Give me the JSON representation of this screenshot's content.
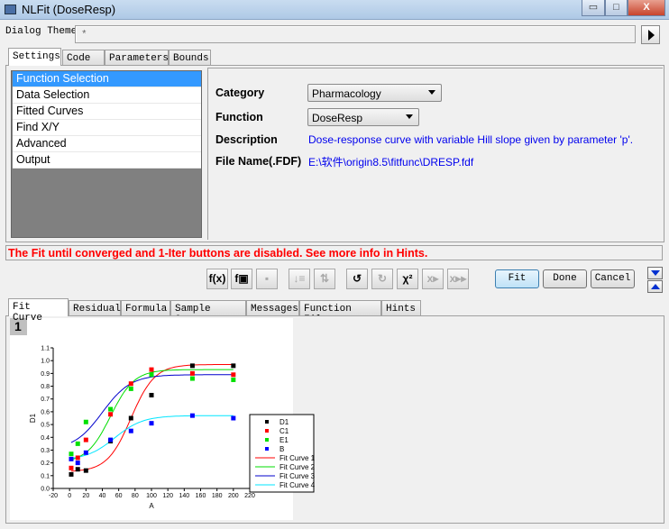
{
  "window": {
    "title": "NLFit (DoseResp)",
    "minimize": "▭",
    "maximize": "□",
    "close": "X"
  },
  "theme": {
    "label": "Dialog Theme",
    "value": "*"
  },
  "top_tabs": [
    {
      "label": "Settings"
    },
    {
      "label": "Code"
    },
    {
      "label": "Parameters"
    },
    {
      "label": "Bounds"
    }
  ],
  "settings_list": [
    {
      "label": "Function Selection"
    },
    {
      "label": "Data Selection"
    },
    {
      "label": "Fitted Curves"
    },
    {
      "label": "Find X/Y"
    },
    {
      "label": "Advanced"
    },
    {
      "label": "Output"
    }
  ],
  "function_selection": {
    "category_label": "Category",
    "category_value": "Pharmacology",
    "function_label": "Function",
    "function_value": "DoseResp",
    "description_label": "Description",
    "description_value": "Dose-response curve with variable Hill slope given by parameter 'p'.",
    "file_label": "File Name(.FDF)",
    "file_value": "E:\\软件\\origin8.5\\fitfunc\\DRESP.fdf"
  },
  "message": "The Fit until converged and 1-Iter buttons are disabled. See more info in Hints.",
  "toolbar": [
    {
      "icon": "function-edit-icon",
      "glyph": "f(x)",
      "enabled": true
    },
    {
      "icon": "function-file-icon",
      "glyph": "f▣",
      "enabled": true
    },
    {
      "icon": "save-icon",
      "glyph": "▪",
      "enabled": false
    },
    {
      "icon": "param-init-icon",
      "glyph": "↓≡",
      "enabled": false
    },
    {
      "icon": "param-swap-icon",
      "glyph": "⇅",
      "enabled": false
    },
    {
      "icon": "undo-icon",
      "glyph": "↺",
      "enabled": true
    },
    {
      "icon": "redo-icon",
      "glyph": "↻",
      "enabled": false
    },
    {
      "icon": "chi-square-icon",
      "glyph": "χ²",
      "enabled": true
    },
    {
      "icon": "one-iteration-icon",
      "glyph": "x▸",
      "enabled": false
    },
    {
      "icon": "fit-until-converged-icon",
      "glyph": "x▸▸",
      "enabled": false
    }
  ],
  "buttons": {
    "fit": "Fit",
    "done": "Done",
    "cancel": "Cancel"
  },
  "bottom_tabs": [
    {
      "label": "Fit Curve"
    },
    {
      "label": "Residual"
    },
    {
      "label": "Formula"
    },
    {
      "label": "Sample Curve"
    },
    {
      "label": "Messages"
    },
    {
      "label": "Function File"
    },
    {
      "label": "Hints"
    }
  ],
  "graph_layer": "1",
  "chart_data": {
    "type": "scatter",
    "xlabel": "A",
    "ylabel": "D1",
    "xlim": [
      -20,
      220
    ],
    "ylim": [
      0,
      1.1
    ],
    "xticks": [
      -20,
      0,
      20,
      40,
      60,
      80,
      100,
      120,
      140,
      160,
      180,
      200,
      220
    ],
    "yticks": [
      "0.0",
      "0.1",
      "0.2",
      "0.3",
      "0.4",
      "0.5",
      "0.6",
      "0.7",
      "0.8",
      "0.9",
      "1.0",
      "1.1"
    ],
    "x": [
      2,
      10,
      20,
      50,
      75,
      100,
      150,
      200
    ],
    "series": [
      {
        "name": "D1",
        "color": "#000000",
        "values": [
          0.11,
          0.15,
          0.14,
          0.37,
          0.55,
          0.73,
          0.96,
          0.96
        ]
      },
      {
        "name": "C1",
        "color": "#ff0000",
        "values": [
          0.16,
          0.24,
          0.38,
          0.58,
          0.82,
          0.93,
          0.9,
          0.89
        ]
      },
      {
        "name": "E1",
        "color": "#00e000",
        "values": [
          0.27,
          0.35,
          0.52,
          0.62,
          0.78,
          0.89,
          0.86,
          0.85
        ]
      },
      {
        "name": "B",
        "color": "#0000ff",
        "values": [
          0.23,
          0.2,
          0.28,
          0.38,
          0.45,
          0.51,
          0.57,
          0.55
        ]
      }
    ],
    "fit_curves": [
      {
        "name": "Fit Curve 1",
        "color": "#ff0000",
        "A1": 0.13,
        "A2": 0.97,
        "LOGx0": 75,
        "p": 0.03
      },
      {
        "name": "Fit Curve 2",
        "color": "#00dd00",
        "A1": 0.2,
        "A2": 0.93,
        "LOGx0": 50,
        "p": 0.03
      },
      {
        "name": "Fit Curve 3",
        "color": "#0000cc",
        "A1": 0.3,
        "A2": 0.89,
        "LOGx0": 40,
        "p": 0.025
      },
      {
        "name": "Fit Curve 4",
        "color": "#00e5ff",
        "A1": 0.22,
        "A2": 0.57,
        "LOGx0": 55,
        "p": 0.025
      }
    ],
    "legend": "bottom-right"
  }
}
